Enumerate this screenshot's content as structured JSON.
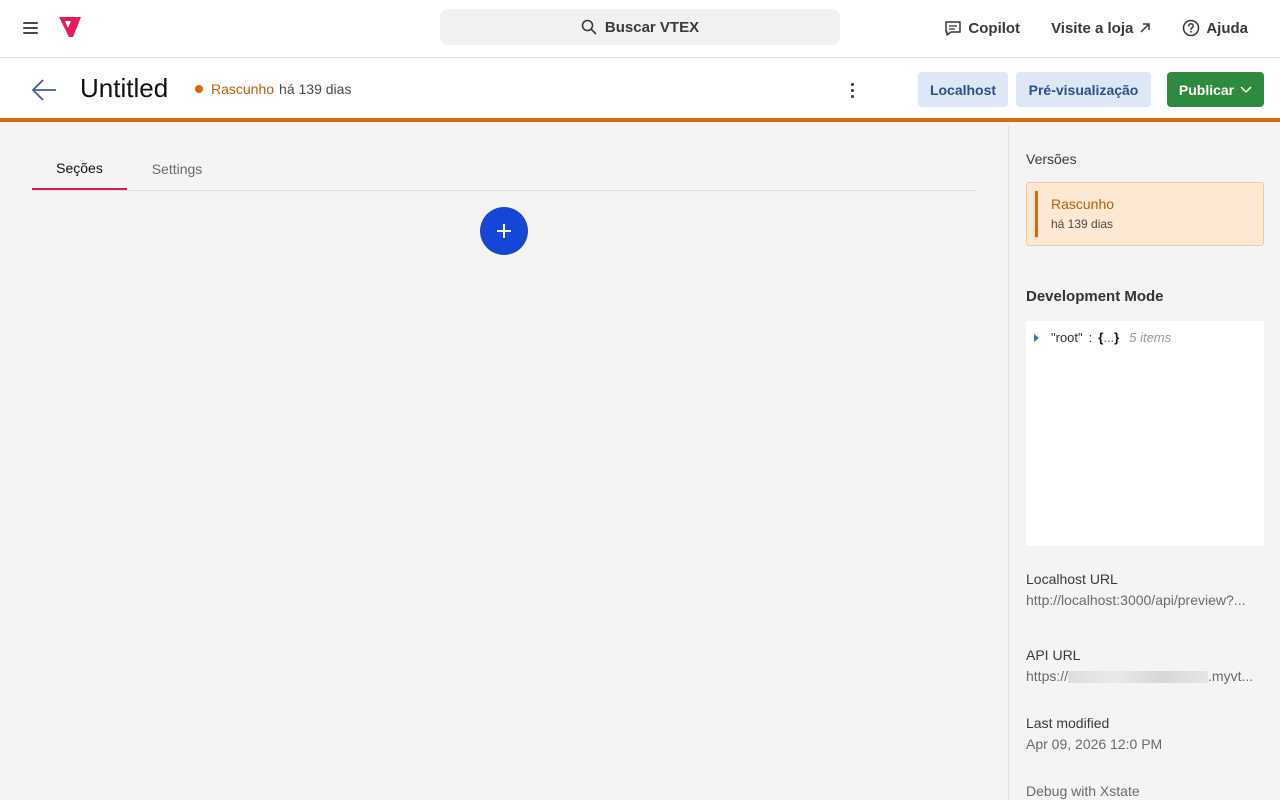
{
  "topbar": {
    "search_label": "Buscar VTEX",
    "copilot_label": "Copilot",
    "visit_store_label": "Visite a loja",
    "help_label": "Ajuda"
  },
  "header": {
    "title": "Untitled",
    "status_label": "Rascunho",
    "status_age": "há 139 dias",
    "localhost_label": "Localhost",
    "preview_label": "Pré-visualização",
    "publish_label": "Publicar"
  },
  "main": {
    "tabs": [
      {
        "label": "Seções",
        "active": true
      },
      {
        "label": "Settings",
        "active": false
      }
    ]
  },
  "sidebar": {
    "versions_label": "Versões",
    "version": {
      "name": "Rascunho",
      "age": "há 139 dias"
    },
    "dev_mode_title": "Development Mode",
    "json": {
      "key": "\"root\"",
      "colon": ":",
      "open": "{",
      "ellipsis": "...",
      "close": "}",
      "count": "5 items"
    },
    "localhost_url_label": "Localhost URL",
    "localhost_url_value": "http://localhost:3000/api/preview?...",
    "api_url_label": "API URL",
    "api_url_prefix": "https://",
    "api_url_suffix": ".myvt...",
    "last_modified_label": "Last modified",
    "last_modified_value": "Apr 09, 2026 12:0 PM",
    "debug_label": "Debug with Xstate"
  },
  "colors": {
    "accent_orange": "#d9670d",
    "primary_blue": "#1547d6",
    "publish_green": "#2e8a3e",
    "brand_pink": "#e31c58"
  }
}
